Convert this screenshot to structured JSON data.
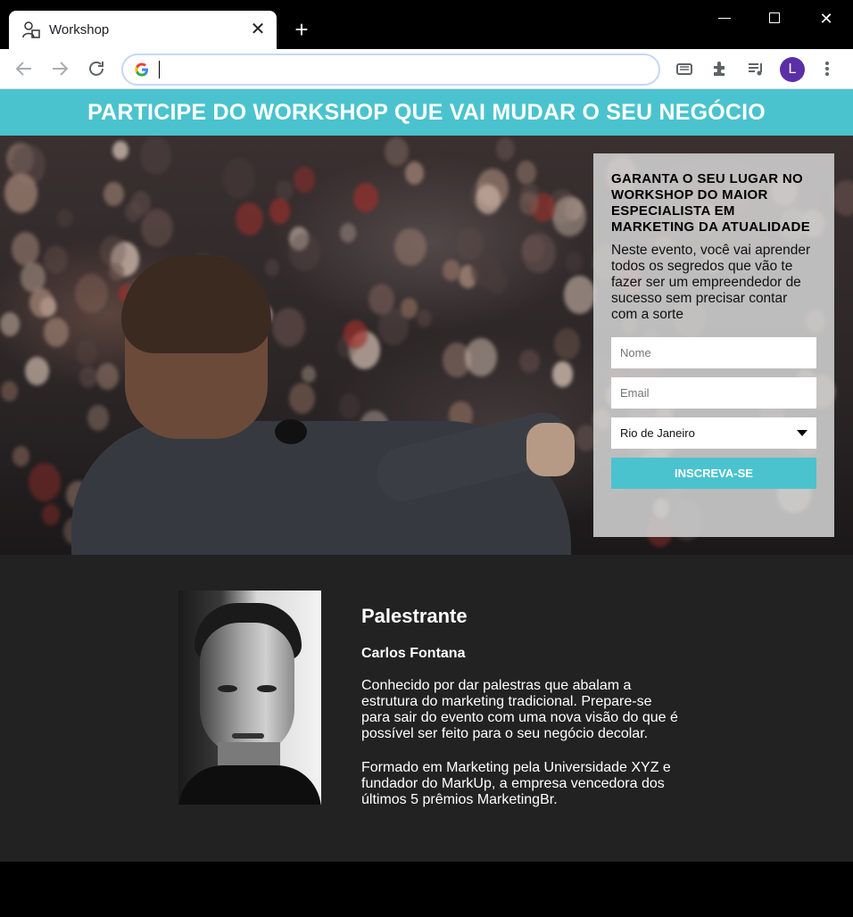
{
  "browser": {
    "tab_title": "Workshop",
    "tab_close": "✕",
    "new_tab": "+",
    "window_close": "✕",
    "avatar_letter": "L",
    "omnibox_value": ""
  },
  "banner": {
    "title": "PARTICIPE DO WORKSHOP QUE VAI MUDAR O SEU NEGÓCIO"
  },
  "form": {
    "title": "GARANTA O SEU LUGAR NO WORKSHOP DO MAIOR ESPECIALISTA EM MARKETING DA ATUALIDADE",
    "description": "Neste evento, você vai aprender todos os segredos que vão te fazer ser um empreendedor de sucesso sem precisar contar com a sorte",
    "name_placeholder": "Nome",
    "email_placeholder": "Email",
    "city_selected": "Rio de Janeiro",
    "submit_label": "INSCREVA-SE"
  },
  "speaker": {
    "heading": "Palestrante",
    "name": "Carlos Fontana",
    "bio_1": "Conhecido por dar palestras que abalam a estrutura do marketing tradicional. Prepare-se para sair do evento com uma nova visão do que é possível ser feito para o seu negócio decolar.",
    "bio_2": "Formado em Marketing pela Universidade XYZ e fundador do MarkUp, a empresa vencedora dos últimos 5 prêmios MarketingBr."
  },
  "colors": {
    "accent": "#4ac3cf",
    "page_dark": "#222222"
  }
}
